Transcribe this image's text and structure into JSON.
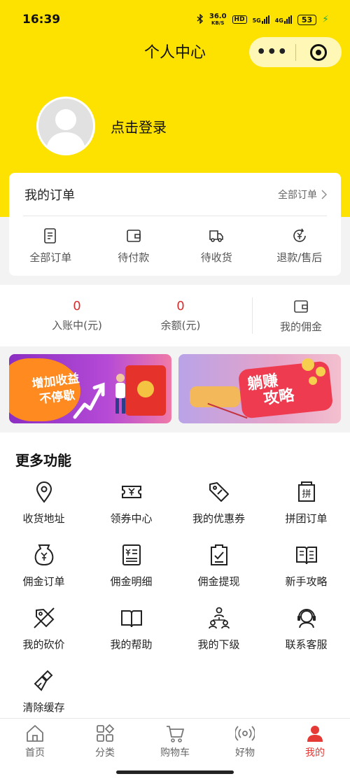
{
  "status": {
    "time": "16:39",
    "net_speed": "36.0",
    "net_unit": "KB/S",
    "hd": "HD",
    "sig1": "5G",
    "sig2": "4G",
    "battery": "53"
  },
  "nav": {
    "title": "个人中心"
  },
  "profile": {
    "login_text": "点击登录"
  },
  "orders": {
    "title": "我的订单",
    "view_all": "全部订单",
    "items": [
      {
        "label": "全部订单",
        "icon": "order-list-icon"
      },
      {
        "label": "待付款",
        "icon": "wallet-icon"
      },
      {
        "label": "待收货",
        "icon": "truck-icon"
      },
      {
        "label": "退款/售后",
        "icon": "refund-icon"
      }
    ]
  },
  "wallet": {
    "incoming": {
      "value": "0",
      "label": "入账中(元)"
    },
    "balance": {
      "value": "0",
      "label": "余额(元)"
    },
    "commission": {
      "label": "我的佣金",
      "icon": "wallet-icon"
    }
  },
  "banners": {
    "left": {
      "line1": "增加收益",
      "line2": "不停歇"
    },
    "right": {
      "line1": "躺赚",
      "line2": "攻略"
    }
  },
  "more": {
    "title": "更多功能",
    "items": [
      {
        "label": "收货地址",
        "icon": "location-pin-icon"
      },
      {
        "label": "领券中心",
        "icon": "coupon-icon"
      },
      {
        "label": "我的优惠券",
        "icon": "price-tag-icon"
      },
      {
        "label": "拼团订单",
        "icon": "group-buy-icon"
      },
      {
        "label": "佣金订单",
        "icon": "money-bag-icon"
      },
      {
        "label": "佣金明细",
        "icon": "ledger-icon"
      },
      {
        "label": "佣金提现",
        "icon": "withdraw-icon"
      },
      {
        "label": "新手攻略",
        "icon": "book-open-icon"
      },
      {
        "label": "我的砍价",
        "icon": "bargain-tag-icon"
      },
      {
        "label": "我的帮助",
        "icon": "help-book-icon"
      },
      {
        "label": "我的下级",
        "icon": "team-icon"
      },
      {
        "label": "联系客服",
        "icon": "customer-service-icon"
      },
      {
        "label": "清除缓存",
        "icon": "broom-icon"
      }
    ]
  },
  "tabbar": {
    "items": [
      {
        "label": "首页",
        "icon": "home-icon"
      },
      {
        "label": "分类",
        "icon": "category-icon"
      },
      {
        "label": "购物车",
        "icon": "cart-icon"
      },
      {
        "label": "好物",
        "icon": "broadcast-icon"
      },
      {
        "label": "我的",
        "icon": "user-icon"
      }
    ],
    "active_color": "#e53935"
  },
  "colors": {
    "header_yellow": "#fde200",
    "accent_red": "#d63030"
  }
}
